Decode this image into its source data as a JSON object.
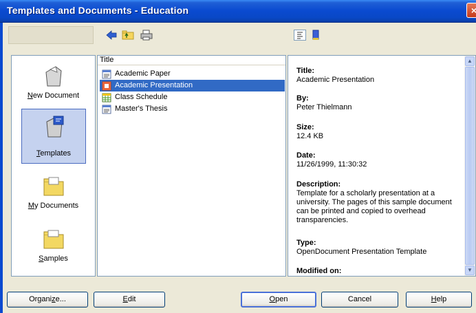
{
  "window": {
    "title": "Templates and Documents - Education",
    "close_glyph": "×"
  },
  "toolbar": {
    "back_icon": "back-arrow-icon",
    "up_icon": "folder-up-icon",
    "print_icon": "printer-icon",
    "preview_icon": "document-properties-icon",
    "preview_toggle_icon": "preview-icon"
  },
  "nav": {
    "items": [
      {
        "label": "New Document",
        "accel": "N",
        "rest": "ew Document",
        "icon": "new-document-icon"
      },
      {
        "label": "Templates",
        "accel": "T",
        "rest": "emplates",
        "icon": "templates-icon"
      },
      {
        "label": "My Documents",
        "accel": "M",
        "rest": "y Documents",
        "icon": "my-documents-folder-icon"
      },
      {
        "label": "Samples",
        "accel": "S",
        "rest": "amples",
        "icon": "samples-folder-icon"
      }
    ]
  },
  "files": {
    "column_header": "Title",
    "rows": [
      {
        "name": "Academic Paper",
        "icon": "text-document-icon"
      },
      {
        "name": "Academic Presentation",
        "icon": "presentation-icon"
      },
      {
        "name": "Class Schedule",
        "icon": "spreadsheet-icon"
      },
      {
        "name": "Master's Thesis",
        "icon": "text-document-icon"
      }
    ]
  },
  "properties": {
    "title_label": "Title:",
    "title_value": "Academic Presentation",
    "by_label": "By:",
    "by_value": "Peter Thielmann",
    "size_label": "Size:",
    "size_value": "12.4 KB",
    "date_label": "Date:",
    "date_value": "11/26/1999, 11:30:32",
    "description_label": "Description:",
    "description_value": "Template for a scholarly presentation at a university. The pages of this sample document can be printed and copied to overhead transparencies.",
    "type_label": "Type:",
    "type_value": "OpenDocument Presentation Template",
    "modified_label": "Modified on:"
  },
  "buttons": {
    "organize": {
      "pre": "Organi",
      "accel": "z",
      "post": "e..."
    },
    "edit": {
      "pre": "",
      "accel": "E",
      "post": "dit"
    },
    "open": {
      "pre": "",
      "accel": "O",
      "post": "pen"
    },
    "cancel": {
      "pre": "Cancel",
      "accel": "",
      "post": ""
    },
    "help": {
      "pre": "",
      "accel": "H",
      "post": "elp"
    }
  },
  "colors": {
    "selection": "#316ac5",
    "titlebar": "#0a4ad0",
    "nav_selected": "#c5d2ef"
  }
}
